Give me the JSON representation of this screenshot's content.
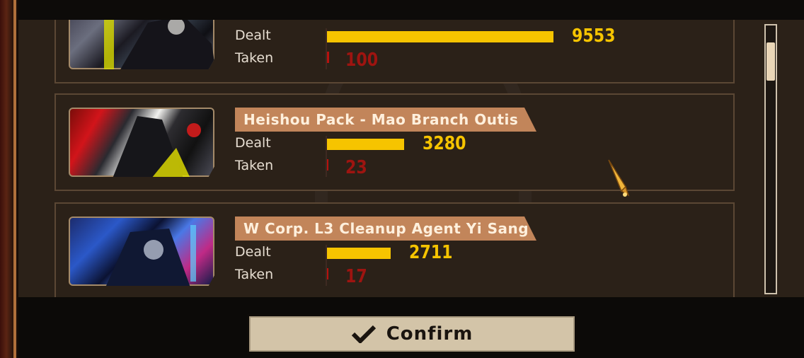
{
  "colors": {
    "dealt_bar": "#f6c400",
    "taken_bar": "#b7110e",
    "taken_text": "#9e1410",
    "name_tag": "#c2855a",
    "button_bg": "#d3c4a8"
  },
  "cards": [
    {
      "name": "",
      "dealt_label": "Dealt",
      "taken_label": "Taken",
      "dealt": "9553",
      "taken": "100",
      "dealt_fraction": 1.0,
      "taken_fraction": 0.01,
      "portrait": "identity-portrait-dark"
    },
    {
      "name": "Heishou Pack - Mao Branch Outis",
      "dealt_label": "Dealt",
      "taken_label": "Taken",
      "dealt": "3280",
      "taken": "23",
      "dealt_fraction": 0.34,
      "taken_fraction": 0.0,
      "portrait": "identity-portrait-outis"
    },
    {
      "name": "W Corp. L3 Cleanup Agent Yi Sang",
      "dealt_label": "Dealt",
      "taken_label": "Taken",
      "dealt": "2711",
      "taken": "17",
      "dealt_fraction": 0.28,
      "taken_fraction": 0.0,
      "portrait": "identity-portrait-yisang"
    }
  ],
  "scroll_position": 0.12,
  "confirm_label": "Confirm",
  "confirm_icon": "checkmark-icon",
  "cursor_icon": "pen-nib-cursor-icon"
}
